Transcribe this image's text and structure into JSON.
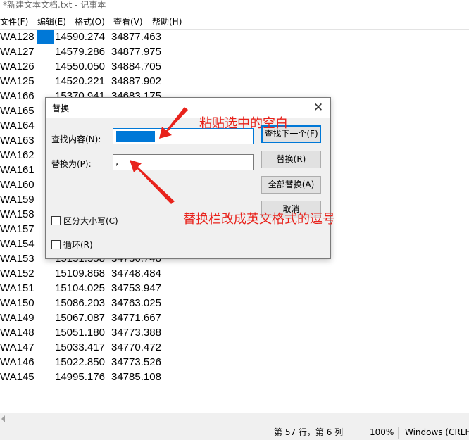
{
  "window": {
    "title": "*新建文本文档.txt - 记事本"
  },
  "menu": [
    {
      "label": "文件(F)"
    },
    {
      "label": "编辑(E)"
    },
    {
      "label": "格式(O)"
    },
    {
      "label": "查看(V)"
    },
    {
      "label": "帮助(H)"
    }
  ],
  "editor": {
    "lines": [
      {
        "id": "WA128",
        "x": "14590.274",
        "y": "34877.463"
      },
      {
        "id": "WA127",
        "x": "14579.286",
        "y": "34877.975"
      },
      {
        "id": "WA126",
        "x": "14550.050",
        "y": "34884.705"
      },
      {
        "id": "WA125",
        "x": "14520.221",
        "y": "34887.902"
      },
      {
        "id": "WA166",
        "x": "15370.941",
        "y": "34683.175"
      },
      {
        "id": "WA165",
        "x": "",
        "y": ""
      },
      {
        "id": "WA164",
        "x": "",
        "y": ""
      },
      {
        "id": "WA163",
        "x": "",
        "y": ""
      },
      {
        "id": "WA162",
        "x": "",
        "y": ""
      },
      {
        "id": "WA161",
        "x": "",
        "y": ""
      },
      {
        "id": "WA160",
        "x": "",
        "y": ""
      },
      {
        "id": "WA159",
        "x": "",
        "y": ""
      },
      {
        "id": "WA158",
        "x": "",
        "y": ""
      },
      {
        "id": "WA157",
        "x": "",
        "y": ""
      },
      {
        "id": "WA154",
        "x": "",
        "y": ""
      },
      {
        "id": "WA153",
        "x": "15131.358",
        "y": "34736.748"
      },
      {
        "id": "WA152",
        "x": "15109.868",
        "y": "34748.484"
      },
      {
        "id": "WA151",
        "x": "15104.025",
        "y": "34753.947"
      },
      {
        "id": "WA150",
        "x": "15086.203",
        "y": "34763.025"
      },
      {
        "id": "WA149",
        "x": "15067.087",
        "y": "34771.667"
      },
      {
        "id": "WA148",
        "x": "15051.180",
        "y": "34773.388"
      },
      {
        "id": "WA147",
        "x": "15033.417",
        "y": "34770.472"
      },
      {
        "id": "WA146",
        "x": "15022.850",
        "y": "34773.526"
      },
      {
        "id": "WA145",
        "x": "14995.176",
        "y": "34785.108"
      }
    ]
  },
  "status": {
    "position": "第 57 行，第 6 列",
    "zoom": "100%",
    "encoding": "Windows (CRLF)"
  },
  "dialog": {
    "title": "替换",
    "find_label": "查找内容(N):",
    "find_value": "",
    "replace_label": "替换为(P):",
    "replace_value": ",",
    "find_next": "查找下一个(F)",
    "replace": "替换(R)",
    "replace_all": "全部替换(A)",
    "cancel": "取消",
    "match_case": "区分大小写(C)",
    "wrap": "循环(R)"
  },
  "annotations": {
    "top": "粘贴选中的空白",
    "bottom": "替换栏改成英文格式的逗号"
  },
  "colors": {
    "selection": "#0078d7",
    "annotation": "#e8221b"
  }
}
